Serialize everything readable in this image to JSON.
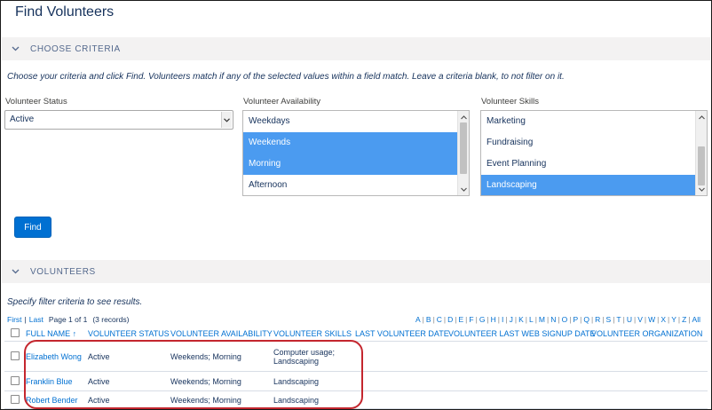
{
  "page": {
    "title": "Find Volunteers"
  },
  "criteria_section": {
    "label": "CHOOSE CRITERIA",
    "instructions": "Choose your criteria and click Find. Volunteers match if any of the selected values within a field match. Leave a criteria blank, to not filter on it."
  },
  "volunteer_status": {
    "label": "Volunteer Status",
    "value": "Active"
  },
  "volunteer_availability": {
    "label": "Volunteer Availability",
    "options": [
      {
        "label": "Weekdays",
        "selected": false
      },
      {
        "label": "Weekends",
        "selected": true
      },
      {
        "label": "Morning",
        "selected": true
      },
      {
        "label": "Afternoon",
        "selected": false
      }
    ]
  },
  "volunteer_skills": {
    "label": "Volunteer Skills",
    "options": [
      {
        "label": "Marketing",
        "selected": false
      },
      {
        "label": "Fundraising",
        "selected": false
      },
      {
        "label": "Event Planning",
        "selected": false
      },
      {
        "label": "Landscaping",
        "selected": true
      }
    ]
  },
  "find_button": {
    "label": "Find"
  },
  "volunteers_section": {
    "label": "VOLUNTEERS",
    "instructions": "Specify filter criteria to see results."
  },
  "pager": {
    "first": "First",
    "sep": "|",
    "last": "Last",
    "page_info": "Page 1 of 1",
    "records": "(3 records)"
  },
  "alphabet": [
    "A",
    "B",
    "C",
    "D",
    "E",
    "F",
    "G",
    "H",
    "I",
    "J",
    "K",
    "L",
    "M",
    "N",
    "O",
    "P",
    "Q",
    "R",
    "S",
    "T",
    "U",
    "V",
    "W",
    "X",
    "Y",
    "Z",
    "All"
  ],
  "table": {
    "headers": {
      "full_name": "FULL NAME ↑",
      "status": "VOLUNTEER STATUS",
      "availability": "VOLUNTEER AVAILABILITY",
      "skills": "VOLUNTEER SKILLS",
      "last_date": "LAST VOLUNTEER DATE",
      "last_web": "VOLUNTEER LAST WEB SIGNUP DATE",
      "organization": "VOLUNTEER ORGANIZATION"
    },
    "rows": [
      {
        "name": "Elizabeth Wong",
        "status": "Active",
        "availability": "Weekends; Morning",
        "skills_line1": "Computer usage;",
        "skills_line2": "Landscaping"
      },
      {
        "name": "Franklin Blue",
        "status": "Active",
        "availability": "Weekends; Morning",
        "skills_line1": "Landscaping",
        "skills_line2": ""
      },
      {
        "name": "Robert Bender",
        "status": "Active",
        "availability": "Weekends; Morning",
        "skills_line1": "Landscaping",
        "skills_line2": ""
      }
    ]
  },
  "colors": {
    "accent": "#0070d2",
    "selected": "#4b9bf0",
    "highlight": "#c4262e"
  }
}
